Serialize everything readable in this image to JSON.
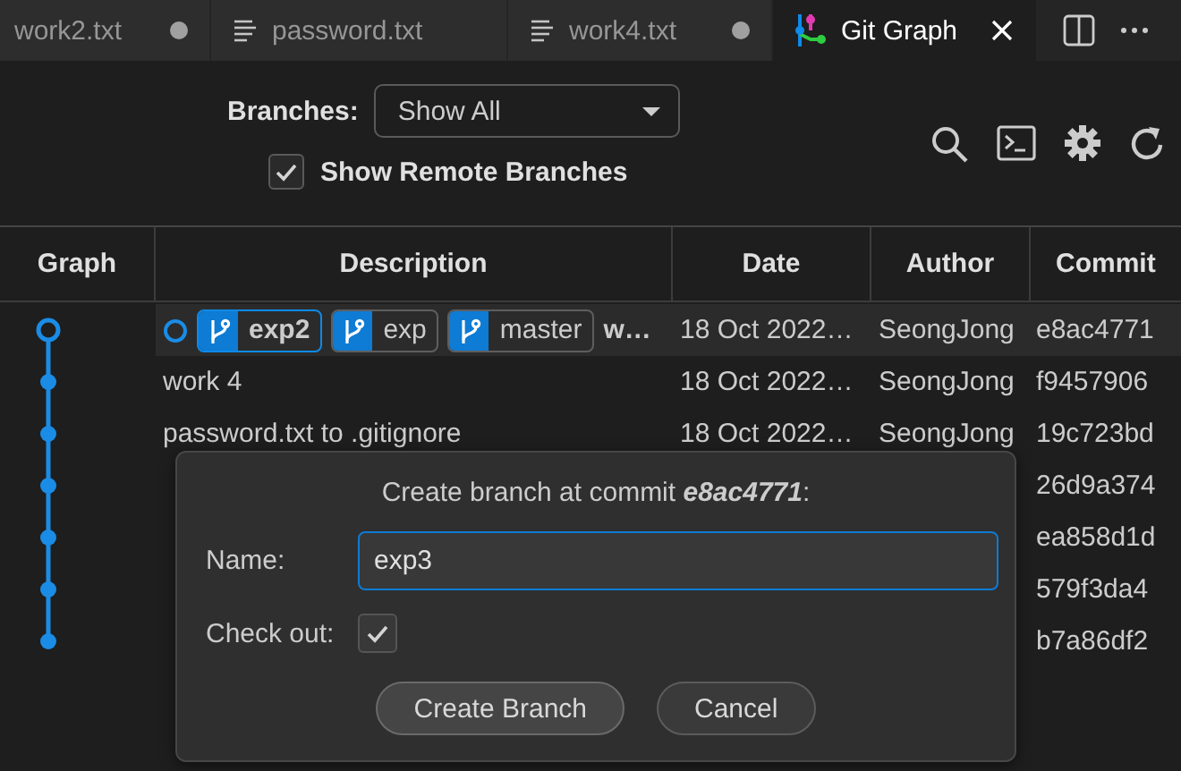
{
  "tabs": [
    {
      "label": "work2.txt",
      "kind": "cut",
      "modified": true,
      "selected": false
    },
    {
      "label": "password.txt",
      "kind": "file",
      "modified": false,
      "selected": false
    },
    {
      "label": "work4.txt",
      "kind": "file",
      "modified": true,
      "selected": false
    },
    {
      "label": "Git Graph",
      "kind": "graph",
      "modified": false,
      "selected": true
    }
  ],
  "branches_filter": {
    "label": "Branches:",
    "value": "Show All"
  },
  "show_remote_branches": {
    "label": "Show Remote Branches",
    "checked": true
  },
  "table": {
    "columns": [
      "Graph",
      "Description",
      "Date",
      "Author",
      "Commit"
    ],
    "rows": [
      {
        "head": true,
        "selected": true,
        "refs": [
          {
            "name": "exp2",
            "checked_out": true
          },
          {
            "name": "exp",
            "checked_out": false
          },
          {
            "name": "master",
            "checked_out": false
          }
        ],
        "description": "w…",
        "date": "18 Oct 2022…",
        "author": "SeongJong",
        "commit": "e8ac4771"
      },
      {
        "head": false,
        "selected": false,
        "description": "work 4",
        "date": "18 Oct 2022…",
        "author": "SeongJong",
        "commit": "f9457906"
      },
      {
        "head": false,
        "selected": false,
        "description": "password.txt to .gitignore",
        "date": "18 Oct 2022…",
        "author": "SeongJong",
        "commit": "19c723bd"
      },
      {
        "head": false,
        "selected": false,
        "commit": "26d9a374"
      },
      {
        "head": false,
        "selected": false,
        "commit": "ea858d1d"
      },
      {
        "head": false,
        "selected": false,
        "commit": "579f3da4"
      },
      {
        "head": false,
        "selected": false,
        "commit": "b7a86df2"
      }
    ]
  },
  "dialog": {
    "title": "Create branch at commit **e8ac4771**:",
    "name_label": "Name:",
    "name_value": "exp3",
    "checkout_label": "Check out:",
    "checkout": true,
    "buttons": [
      "Create Branch",
      "Cancel"
    ]
  }
}
